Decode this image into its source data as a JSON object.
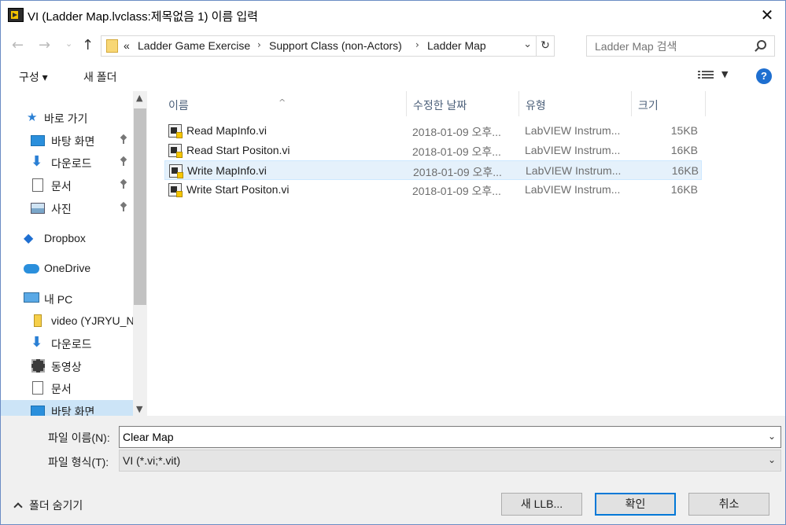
{
  "title": "VI (Ladder Map.lvclass:제목없음 1) 이름 입력",
  "address": {
    "overflow": "«",
    "crumbs": [
      "Ladder Game Exercise",
      "Support Class (non-Actors)",
      "Ladder Map"
    ]
  },
  "search": {
    "placeholder": "Ladder Map 검색"
  },
  "toolbar": {
    "organize_label": "구성 ▾",
    "new_folder_label": "새 폴더"
  },
  "nav": {
    "quick_access": "바로 가기",
    "items": [
      {
        "label": "바탕 화면",
        "icon": "desktop-icon",
        "pinned": true
      },
      {
        "label": "다운로드",
        "icon": "download-icon",
        "pinned": true
      },
      {
        "label": "문서",
        "icon": "document-icon",
        "pinned": true
      },
      {
        "label": "사진",
        "icon": "picture-icon",
        "pinned": true
      }
    ],
    "dropbox": "Dropbox",
    "onedrive": "OneDrive",
    "this_pc": "내 PC",
    "pc_items": [
      {
        "label": "video (YJRYU_N/",
        "icon": "usb-drive-icon"
      },
      {
        "label": "다운로드",
        "icon": "download-icon"
      },
      {
        "label": "동영상",
        "icon": "video-icon"
      },
      {
        "label": "문서",
        "icon": "document-icon"
      },
      {
        "label": "바탕 화면",
        "icon": "desktop-icon"
      }
    ]
  },
  "columns": {
    "name": "이름",
    "date": "수정한 날짜",
    "type": "유형",
    "size": "크기"
  },
  "files": [
    {
      "name": "Read MapInfo.vi",
      "date": "2018-01-09 오후...",
      "type": "LabVIEW Instrum...",
      "size": "15KB"
    },
    {
      "name": "Read Start Positon.vi",
      "date": "2018-01-09 오후...",
      "type": "LabVIEW Instrum...",
      "size": "16KB"
    },
    {
      "name": "Write MapInfo.vi",
      "date": "2018-01-09 오후...",
      "type": "LabVIEW Instrum...",
      "size": "16KB"
    },
    {
      "name": "Write Start Positon.vi",
      "date": "2018-01-09 오후...",
      "type": "LabVIEW Instrum...",
      "size": "16KB"
    }
  ],
  "form": {
    "filename_label": "파일 이름(N):",
    "filename_value": "Clear Map",
    "filetype_label": "파일 형식(T):",
    "filetype_value": "VI (*.vi;*.vit)"
  },
  "footer": {
    "hide_folders": "폴더 숨기기",
    "new_llb": "새 LLB...",
    "ok": "확인",
    "cancel": "취소"
  }
}
